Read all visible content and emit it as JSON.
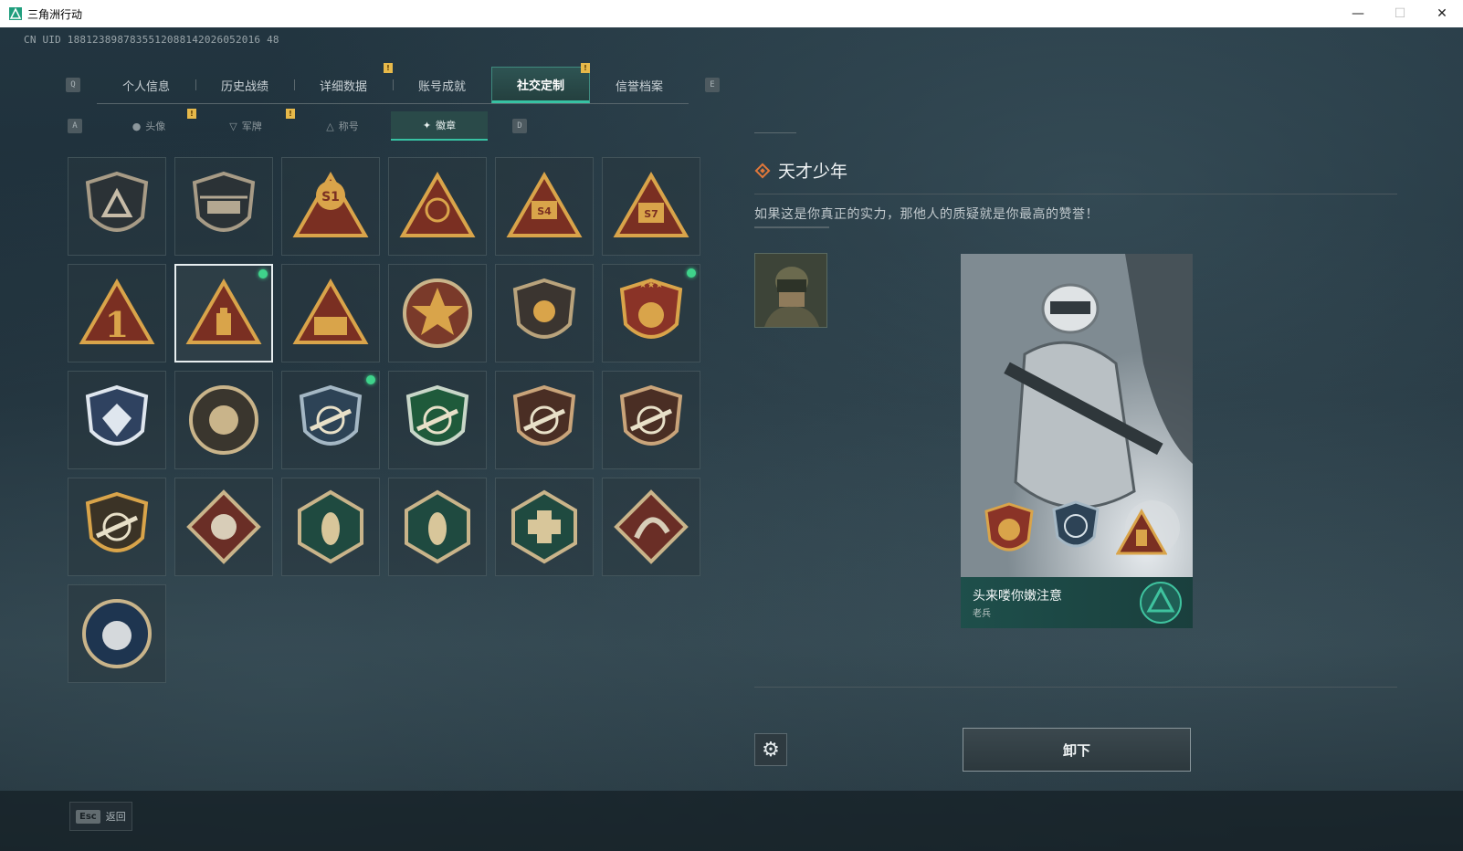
{
  "window": {
    "title": "三角洲行动",
    "controls": [
      "—",
      "☐",
      "✕"
    ]
  },
  "uid_text": "CN UID 1881238987835512088142026052016 48",
  "main_tabs": {
    "left_key": "Q",
    "right_key": "E",
    "items": [
      {
        "label": "个人信息",
        "active": false
      },
      {
        "label": "历史战绩",
        "active": false
      },
      {
        "label": "详细数据",
        "active": false,
        "flag": true
      },
      {
        "label": "账号成就",
        "active": false
      },
      {
        "label": "社交定制",
        "active": true,
        "flag": true
      },
      {
        "label": "信誉档案",
        "active": false
      }
    ]
  },
  "sub_tabs": {
    "left_key": "A",
    "right_key": "D",
    "items": [
      {
        "label": "头像",
        "icon": "user-icon",
        "active": false,
        "flag": true
      },
      {
        "label": "军牌",
        "icon": "dogtag-icon",
        "active": false,
        "flag": true
      },
      {
        "label": "称号",
        "icon": "title-icon",
        "active": false
      },
      {
        "label": "徽章",
        "icon": "badge-icon",
        "active": true
      }
    ]
  },
  "badges": [
    {
      "name": "delta-shield-badge",
      "equipped": false
    },
    {
      "name": "helicopter-badge",
      "equipped": false
    },
    {
      "name": "s1-balloon-badge",
      "equipped": false
    },
    {
      "name": "gyroscope-badge",
      "equipped": false
    },
    {
      "name": "s4-badge",
      "equipped": false
    },
    {
      "name": "s7-badge",
      "equipped": false
    },
    {
      "name": "number-one-badge",
      "equipped": false
    },
    {
      "name": "usb-drive-badge",
      "equipped": true,
      "selected": true
    },
    {
      "name": "soldiers-badge",
      "equipped": false
    },
    {
      "name": "star-emblem-badge",
      "equipped": false
    },
    {
      "name": "bronze-shield-badge",
      "equipped": false
    },
    {
      "name": "gold-stars-shield-badge",
      "equipped": true
    },
    {
      "name": "diamond-shield-badge",
      "equipped": false
    },
    {
      "name": "skull-crosshair-badge",
      "equipped": false
    },
    {
      "name": "rifle-crosshair-blue-badge",
      "equipped": true
    },
    {
      "name": "rifle-crosshair-green-badge",
      "equipped": false
    },
    {
      "name": "rifle-crosshair-bronze-badge",
      "equipped": false
    },
    {
      "name": "rifle-crosshair-bronze2-badge",
      "equipped": false
    },
    {
      "name": "gold-rifle-laurel-badge",
      "equipped": false
    },
    {
      "name": "wolf-diamond-badge",
      "equipped": false
    },
    {
      "name": "wasp-hexagon-badge",
      "equipped": false
    },
    {
      "name": "wasp-hexagon2-badge",
      "equipped": false
    },
    {
      "name": "medic-hexagon-badge",
      "equipped": false
    },
    {
      "name": "dragon-diamond-badge",
      "equipped": false
    },
    {
      "name": "lynx-circle-badge",
      "equipped": false
    }
  ],
  "detail": {
    "title": "天才少年",
    "description": "如果这是你真正的实力，那他人的质疑就是你最高的赞誉！",
    "card_name": "头来喽你嫩注意",
    "card_sub": "老兵",
    "unequip_label": "卸下"
  },
  "footer": {
    "esc_key": "Esc",
    "esc_label": "返回"
  },
  "colors": {
    "accent": "#37c2a3",
    "flag": "#e7b94a",
    "equipped_dot": "#3fd38b"
  }
}
